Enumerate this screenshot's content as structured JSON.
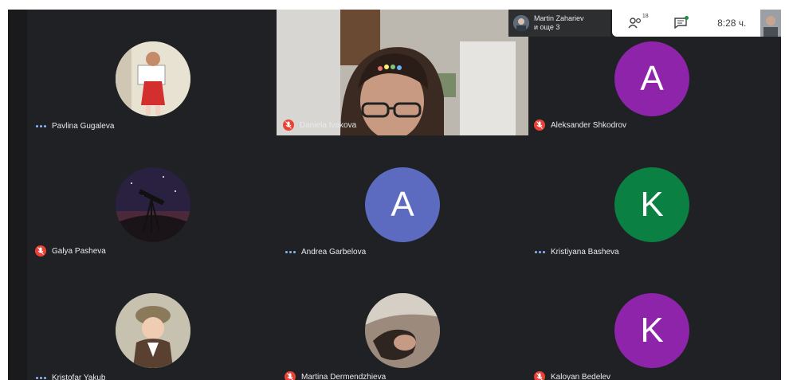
{
  "presenter": {
    "name": "Martin Zahariev",
    "subtitle": "и още 3"
  },
  "topbar": {
    "people_badge": "18",
    "time": "8:28 ч."
  },
  "video_tile": {
    "name": "Daniela Ivakova"
  },
  "participants": [
    {
      "name": "Pavlina Gugaleva",
      "status": "speaking-dots",
      "avatar": "photo"
    },
    {
      "name": "Aleksander Shkodrov",
      "status": "muted",
      "avatar": "letter",
      "letter": "A",
      "color": "#8e24aa"
    },
    {
      "name": "Galya Pasheva",
      "status": "muted",
      "avatar": "photo"
    },
    {
      "name": "Andrea Garbelova",
      "status": "speaking-dots",
      "avatar": "letter",
      "letter": "A",
      "color": "#5c6bc0"
    },
    {
      "name": "Kristiyana Basheva",
      "status": "speaking-dots",
      "avatar": "letter",
      "letter": "K",
      "color": "#0b8043"
    },
    {
      "name": "Kristofar Yakub",
      "status": "speaking-dots",
      "avatar": "photo"
    },
    {
      "name": "Martina Dermendzhieva",
      "status": "muted",
      "avatar": "photo"
    },
    {
      "name": "Kaloyan Bedelev",
      "status": "muted",
      "avatar": "letter",
      "letter": "K",
      "color": "#8e24aa"
    }
  ],
  "icons": [
    "mic-off-icon",
    "more-dots-icon",
    "people-icon",
    "chat-icon"
  ]
}
